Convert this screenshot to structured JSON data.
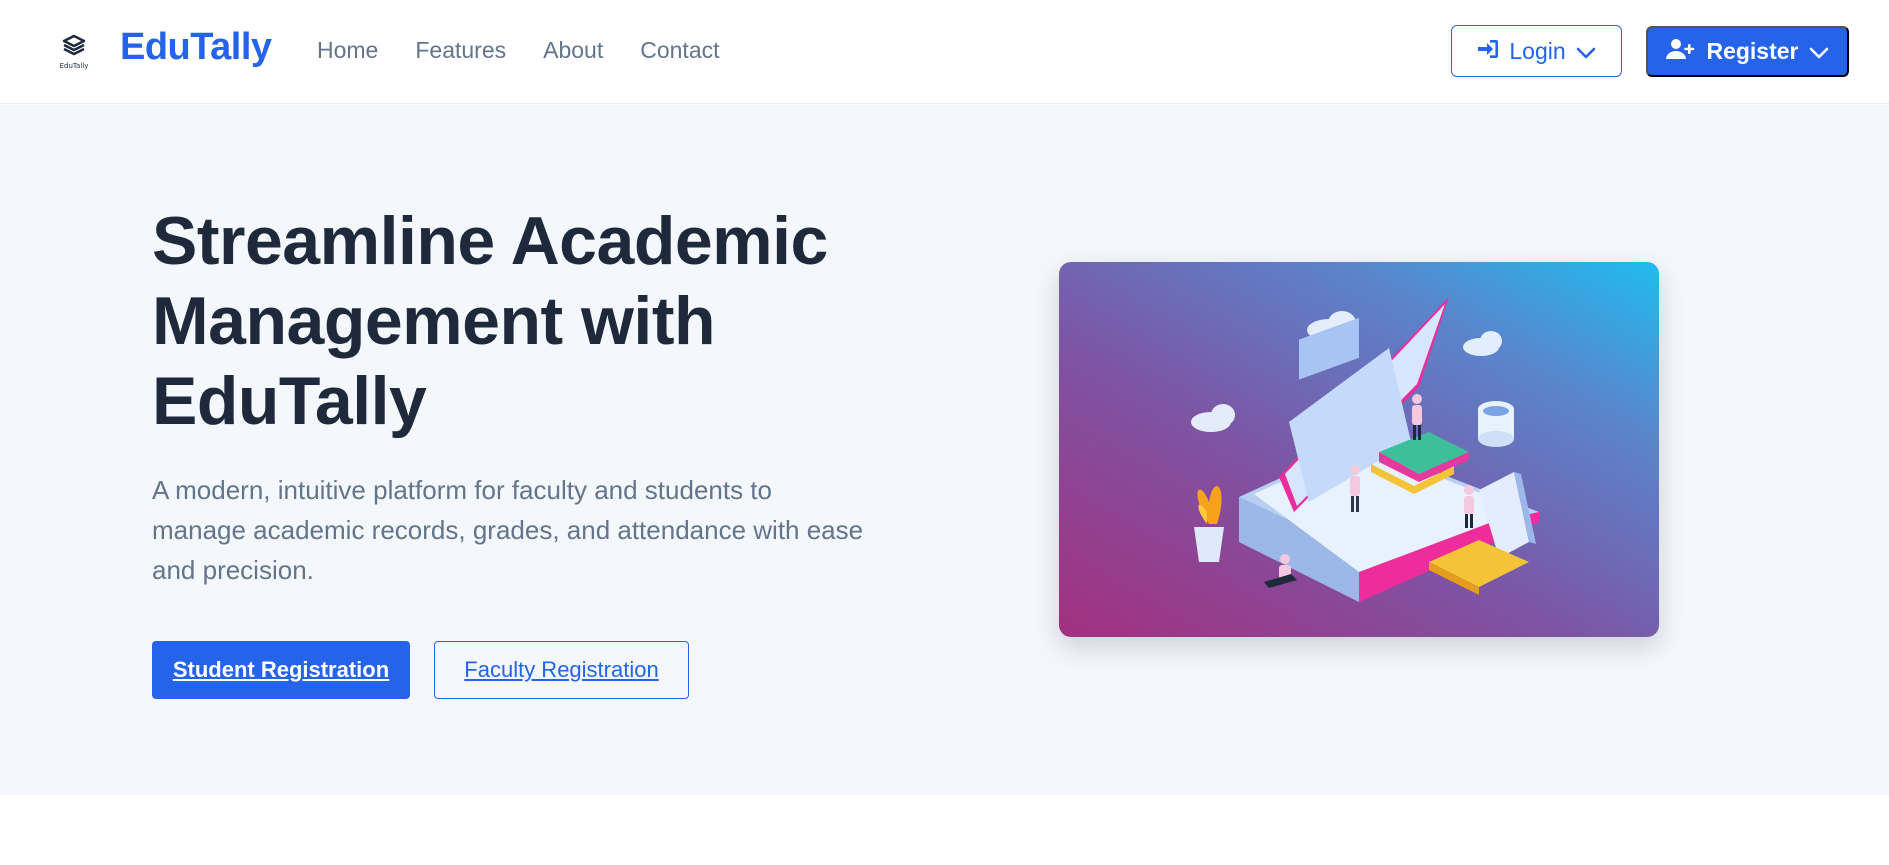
{
  "brand": {
    "logo_alt_text": "EduTally",
    "name": "EduTally",
    "color": "#2563eb"
  },
  "nav": {
    "links": [
      "Home",
      "Features",
      "About",
      "Contact"
    ]
  },
  "actions": {
    "login": {
      "label": "Login",
      "icon": "sign-in-icon"
    },
    "register": {
      "label": "Register",
      "icon": "user-plus-icon"
    }
  },
  "hero": {
    "title": "Streamline Academic Management with EduTally",
    "subtitle": "A modern, intuitive platform for faculty and students to manage academic records, grades, and attendance with ease and precision.",
    "student_button": "Student Registration",
    "faculty_button": "Faculty Registration",
    "illustration": "isometric-laptop-education-illustration"
  },
  "colors": {
    "primary": "#2563eb",
    "hero_bg": "#f4f7fb",
    "heading": "#1e293b",
    "muted": "#64748b"
  }
}
